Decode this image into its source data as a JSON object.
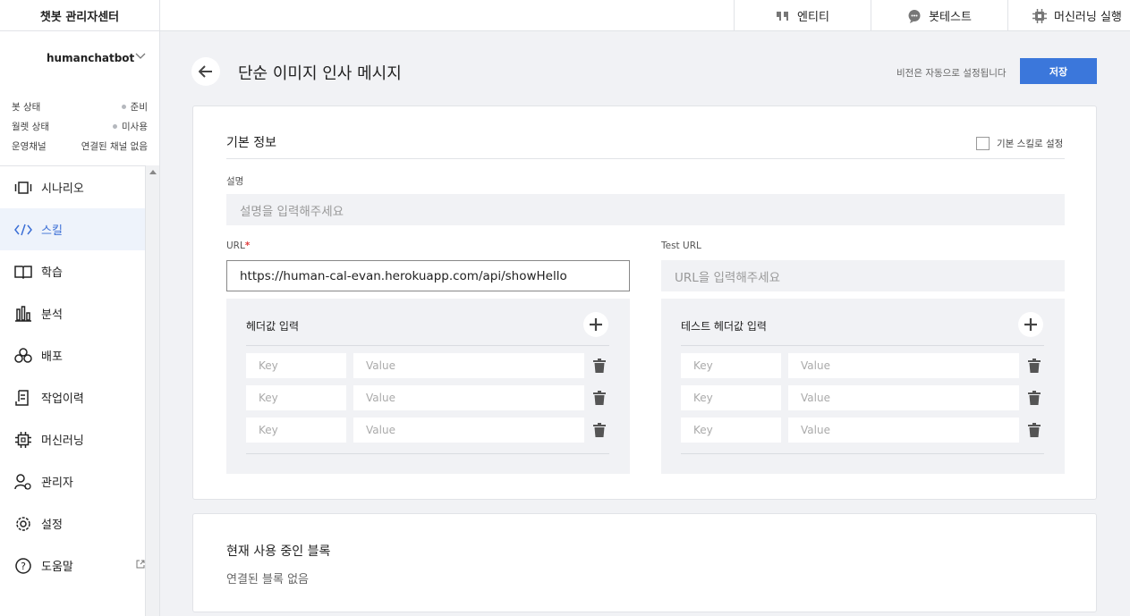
{
  "brand": {
    "title": "챗봇 관리자센터"
  },
  "topnav": {
    "entity": "엔티티",
    "bot_test": "봇테스트",
    "ml_run": "머신러닝 실행"
  },
  "sidebar": {
    "bot_name": "humanchatbot",
    "status": [
      {
        "key": "봇 상태",
        "value": "준비",
        "dot": true
      },
      {
        "key": "월렛 상태",
        "value": "미사용",
        "dot": true
      },
      {
        "key": "운영채널",
        "value": "연결된 채널 없음",
        "dot": false
      }
    ],
    "items": [
      {
        "label": "시나리오",
        "icon": "scenario-icon"
      },
      {
        "label": "스킬",
        "icon": "code-icon",
        "active": true
      },
      {
        "label": "학습",
        "icon": "book-icon"
      },
      {
        "label": "분석",
        "icon": "bar-chart-icon"
      },
      {
        "label": "배포",
        "icon": "deploy-icon"
      },
      {
        "label": "작업이력",
        "icon": "history-icon"
      },
      {
        "label": "머신러닝",
        "icon": "chip-icon"
      },
      {
        "label": "관리자",
        "icon": "admin-icon"
      },
      {
        "label": "설정",
        "icon": "gear-icon"
      },
      {
        "label": "도움말",
        "icon": "help-icon"
      }
    ]
  },
  "header": {
    "title": "단순 이미지 인사 메시지",
    "auto_save": "비전은 자동으로 설정됩니다",
    "save_label": "저장"
  },
  "basic_info": {
    "title": "기본 정보",
    "default_skill_label": "기본 스킬로 설정",
    "desc_label": "설명",
    "desc_placeholder": "설명을 입력해주세요",
    "url_label": "URL",
    "url_required": "*",
    "url_value": "https://human-cal-evan.herokuapp.com/api/showHello",
    "test_url_label": "Test URL",
    "test_url_placeholder": "URL을 입력해주세요",
    "headers": {
      "title": "헤더값 입력",
      "rows": [
        {
          "key": "Key",
          "value": "Value"
        },
        {
          "key": "Key",
          "value": "Value"
        },
        {
          "key": "Key",
          "value": "Value"
        }
      ]
    },
    "test_headers": {
      "title": "테스트 헤더값 입력",
      "rows": [
        {
          "key": "Key",
          "value": "Value"
        },
        {
          "key": "Key",
          "value": "Value"
        },
        {
          "key": "Key",
          "value": "Value"
        }
      ]
    }
  },
  "used_blocks": {
    "title": "현재 사용 중인 블록",
    "empty": "연결된 블록 없음"
  },
  "colors": {
    "accent": "#3b77db",
    "active_bg": "#eef3fb",
    "required": "#e03a3a"
  }
}
